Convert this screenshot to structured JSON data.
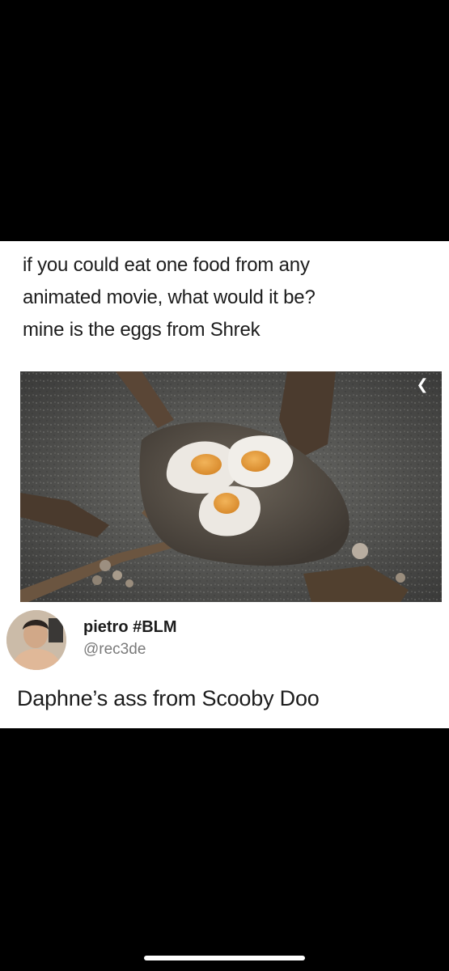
{
  "post": {
    "lines": [
      "if you could eat one food from any",
      "animated movie, what would it be?",
      "mine is the eggs from Shrek"
    ],
    "image": {
      "icon": "chevron-left-icon"
    }
  },
  "reply": {
    "name": "pietro #BLM",
    "handle": "@rec3de",
    "text": "Daphne’s ass from Scooby Doo"
  },
  "colors": {
    "background": "#000000",
    "card": "#ffffff",
    "text": "#1c1c1c",
    "handle": "#7a7a7a"
  }
}
